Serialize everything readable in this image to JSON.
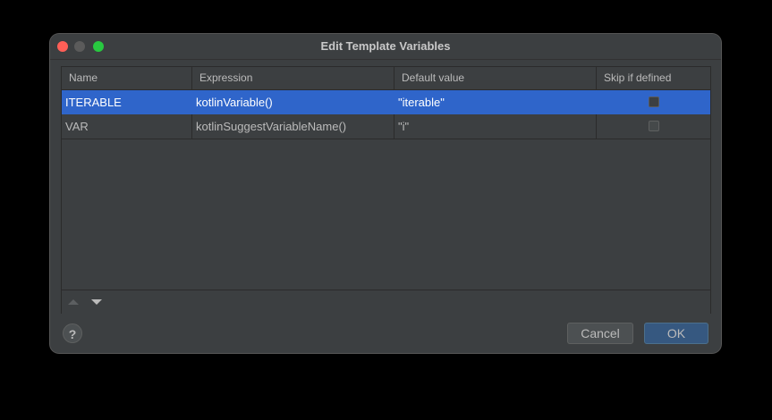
{
  "window": {
    "title": "Edit Template Variables"
  },
  "table": {
    "columns": [
      "Name",
      "Expression",
      "Default value",
      "Skip if defined"
    ],
    "rows": [
      {
        "name": "ITERABLE",
        "expression": "kotlinVariable()",
        "default_value": "\"iterable\"",
        "skip_if_defined": false,
        "selected": true
      },
      {
        "name": "VAR",
        "expression": "kotlinSuggestVariableName()",
        "default_value": "\"i\"",
        "skip_if_defined": false,
        "selected": false
      }
    ]
  },
  "toolbar": {
    "move_up_icon": "arrow-up-icon",
    "move_down_icon": "arrow-down-icon"
  },
  "footer": {
    "help_label": "?",
    "cancel_label": "Cancel",
    "ok_label": "OK"
  },
  "colors": {
    "selection": "#2f65ca",
    "dialog_bg": "#3c3f41",
    "ok_button": "#365880"
  }
}
